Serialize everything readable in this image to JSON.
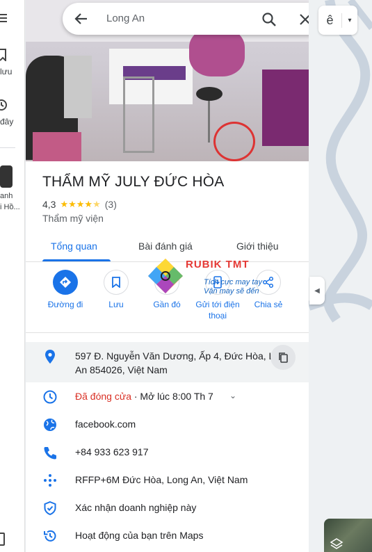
{
  "search": {
    "query": "Long An"
  },
  "rail": {
    "saved_label": "lưu",
    "recent_label": "đây",
    "recent_place_line1": "anh",
    "recent_place_line2": "i Hồ..."
  },
  "map": {
    "layer_button_label": "ê"
  },
  "place": {
    "name": "THẨM MỸ JULY ĐỨC HÒA",
    "rating": "4,3",
    "review_count": "(3)",
    "category": "Thẩm mỹ viện"
  },
  "tabs": [
    {
      "label": "Tổng quan"
    },
    {
      "label": "Bài đánh giá"
    },
    {
      "label": "Giới thiệu"
    }
  ],
  "actions": [
    {
      "label": "Đường đi",
      "icon": "directions-icon"
    },
    {
      "label": "Lưu",
      "icon": "bookmark-icon"
    },
    {
      "label": "Gần đó",
      "icon": "nearby-icon"
    },
    {
      "label": "Gửi tới điện thoại",
      "icon": "send-to-phone-icon"
    },
    {
      "label": "Chia sẻ",
      "icon": "share-icon"
    }
  ],
  "watermark": {
    "title": "RUBIK TMT",
    "line1": "Tích cực may tay",
    "line2": "Vận may sẽ đến"
  },
  "info": {
    "address_line1": "597 Đ. Nguyễn Văn Dương, Ấp 4, Đức Hòa, L",
    "address_line2": "An 854026, Việt Nam",
    "hours_status": "Đã đóng cửa",
    "hours_next": " · Mở lúc 8:00 Th 7",
    "website": "facebook.com",
    "phone": "+84 933 623 917",
    "plus_code": "RFFP+6M Đức Hòa, Long An, Việt Nam",
    "claim": "Xác nhận doanh nghiệp này",
    "activity": "Hoạt động của bạn trên Maps"
  },
  "colors": {
    "accent": "#1a73e8",
    "closed": "#d93025",
    "star": "#fbbc04"
  }
}
